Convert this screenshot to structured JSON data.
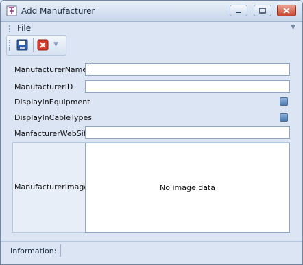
{
  "window": {
    "title": "Add Manufacturer"
  },
  "menu": {
    "file": "File"
  },
  "toolbar": {
    "save": "save-icon",
    "cancel": "cancel-icon"
  },
  "form": {
    "manufacturer_name_label": "ManufacturerName",
    "manufacturer_name_value": "",
    "manufacturer_id_label": "ManufacturerID",
    "manufacturer_id_value": "",
    "display_in_equipment_label": "DisplayInEquipment",
    "display_in_cable_types_label": "DisplayInCableTypes",
    "website_label": "ManfacturerWebSite",
    "website_value": "",
    "image_label": "ManufacturerImage",
    "image_placeholder": "No image data"
  },
  "status": {
    "information_label": "Information:"
  }
}
